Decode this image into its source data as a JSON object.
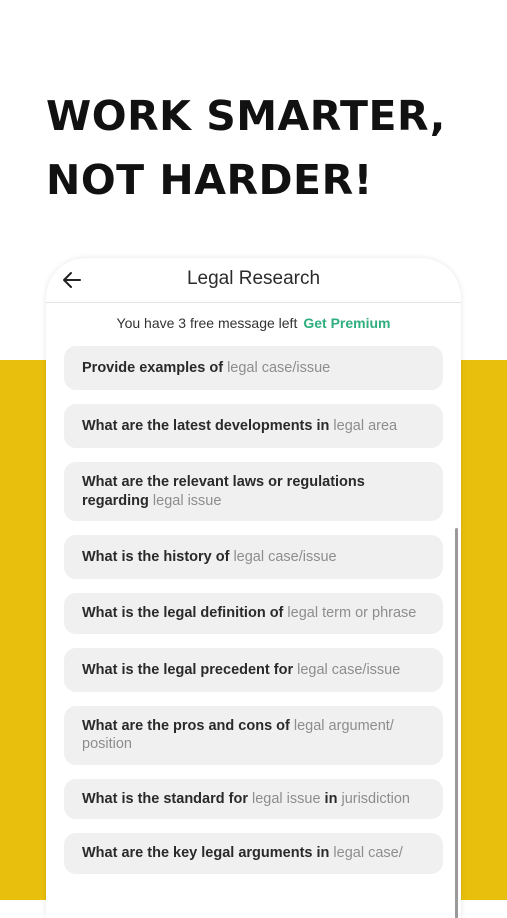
{
  "headline": {
    "line1": "WORK SMARTER,",
    "line2": "NOT HARDER!"
  },
  "colors": {
    "accent_yellow": "#e8bf0c",
    "premium_green": "#2fae7e",
    "card_bg": "#f0f0f0"
  },
  "nav": {
    "title": "Legal Research",
    "back_icon": "back-arrow-icon"
  },
  "free_messages": {
    "text": "You have 3 free message left",
    "cta": "Get Premium"
  },
  "prompts": [
    {
      "bold": "Provide examples of",
      "placeholder": "legal case/issue",
      "tail": ""
    },
    {
      "bold": "What are the latest developments in",
      "placeholder": "legal area",
      "tail": ""
    },
    {
      "bold": "What are the relevant laws or regulations regarding",
      "placeholder": "legal issue",
      "tail": ""
    },
    {
      "bold": "What is the history of",
      "placeholder": "legal case/issue",
      "tail": ""
    },
    {
      "bold": "What is the legal definition of",
      "placeholder": "legal term or phrase",
      "tail": ""
    },
    {
      "bold": "What is the legal precedent for",
      "placeholder": "legal case/issue",
      "tail": ""
    },
    {
      "bold": "What are the pros and cons of",
      "placeholder": "legal argument/ position",
      "tail": ""
    },
    {
      "bold": "What is the standard for",
      "placeholder": "legal issue",
      "tail": "in",
      "tail_placeholder": "jurisdiction"
    },
    {
      "bold": "What are the key legal arguments in",
      "placeholder": "legal case/",
      "tail": ""
    }
  ]
}
